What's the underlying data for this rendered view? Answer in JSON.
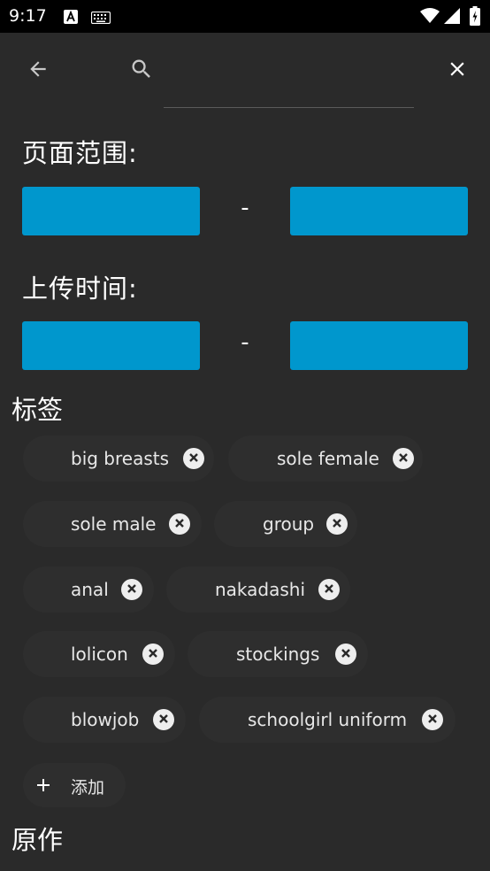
{
  "status_bar": {
    "time": "9:17",
    "icons": [
      "a-notification-icon",
      "keyboard-icon",
      "wifi-icon",
      "signal-icon",
      "battery-icon"
    ]
  },
  "app_bar": {
    "back_icon": "arrow-left-icon",
    "search_icon": "search-icon",
    "close_icon": "close-icon",
    "search_value": "",
    "search_placeholder": ""
  },
  "page_range": {
    "title": "页面范围:",
    "from_value": "",
    "to_value": "",
    "separator": "-"
  },
  "upload_time": {
    "title": "上传时间:",
    "from_value": "",
    "to_value": "",
    "separator": "-"
  },
  "tags": {
    "title": "标签",
    "items": [
      {
        "label": "big breasts"
      },
      {
        "label": "sole female"
      },
      {
        "label": "sole male"
      },
      {
        "label": "group"
      },
      {
        "label": "anal"
      },
      {
        "label": "nakadashi"
      },
      {
        "label": "lolicon"
      },
      {
        "label": "stockings"
      },
      {
        "label": "blowjob"
      },
      {
        "label": "schoolgirl uniform"
      }
    ],
    "add_label": "添加"
  },
  "source": {
    "title": "原作"
  },
  "colors": {
    "background": "#2a2a2a",
    "accent": "#0097cd",
    "chip": "#2e2e2e",
    "status_bar": "#000000"
  }
}
